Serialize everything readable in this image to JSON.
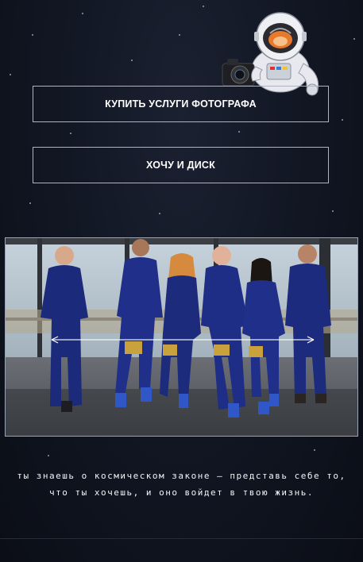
{
  "buttons": {
    "buy_photographer": "КУПИТЬ УСЛУГИ ФОТОГРАФА",
    "want_disk": "ХОЧУ И ДИСК"
  },
  "mascot": {
    "icon": "astronaut-with-camera-icon"
  },
  "slider": {
    "icon": "compare-slider-arrows-icon"
  },
  "caption": {
    "text": "ты знаешь о космическом законе — представь себе то, что ты хочешь, и оно войдет в твою жизнь."
  },
  "colors": {
    "background": "#121724",
    "button_border": "#aeb3bf",
    "suit_blue": "#1b2a7a",
    "gold": "#c9a23e"
  }
}
